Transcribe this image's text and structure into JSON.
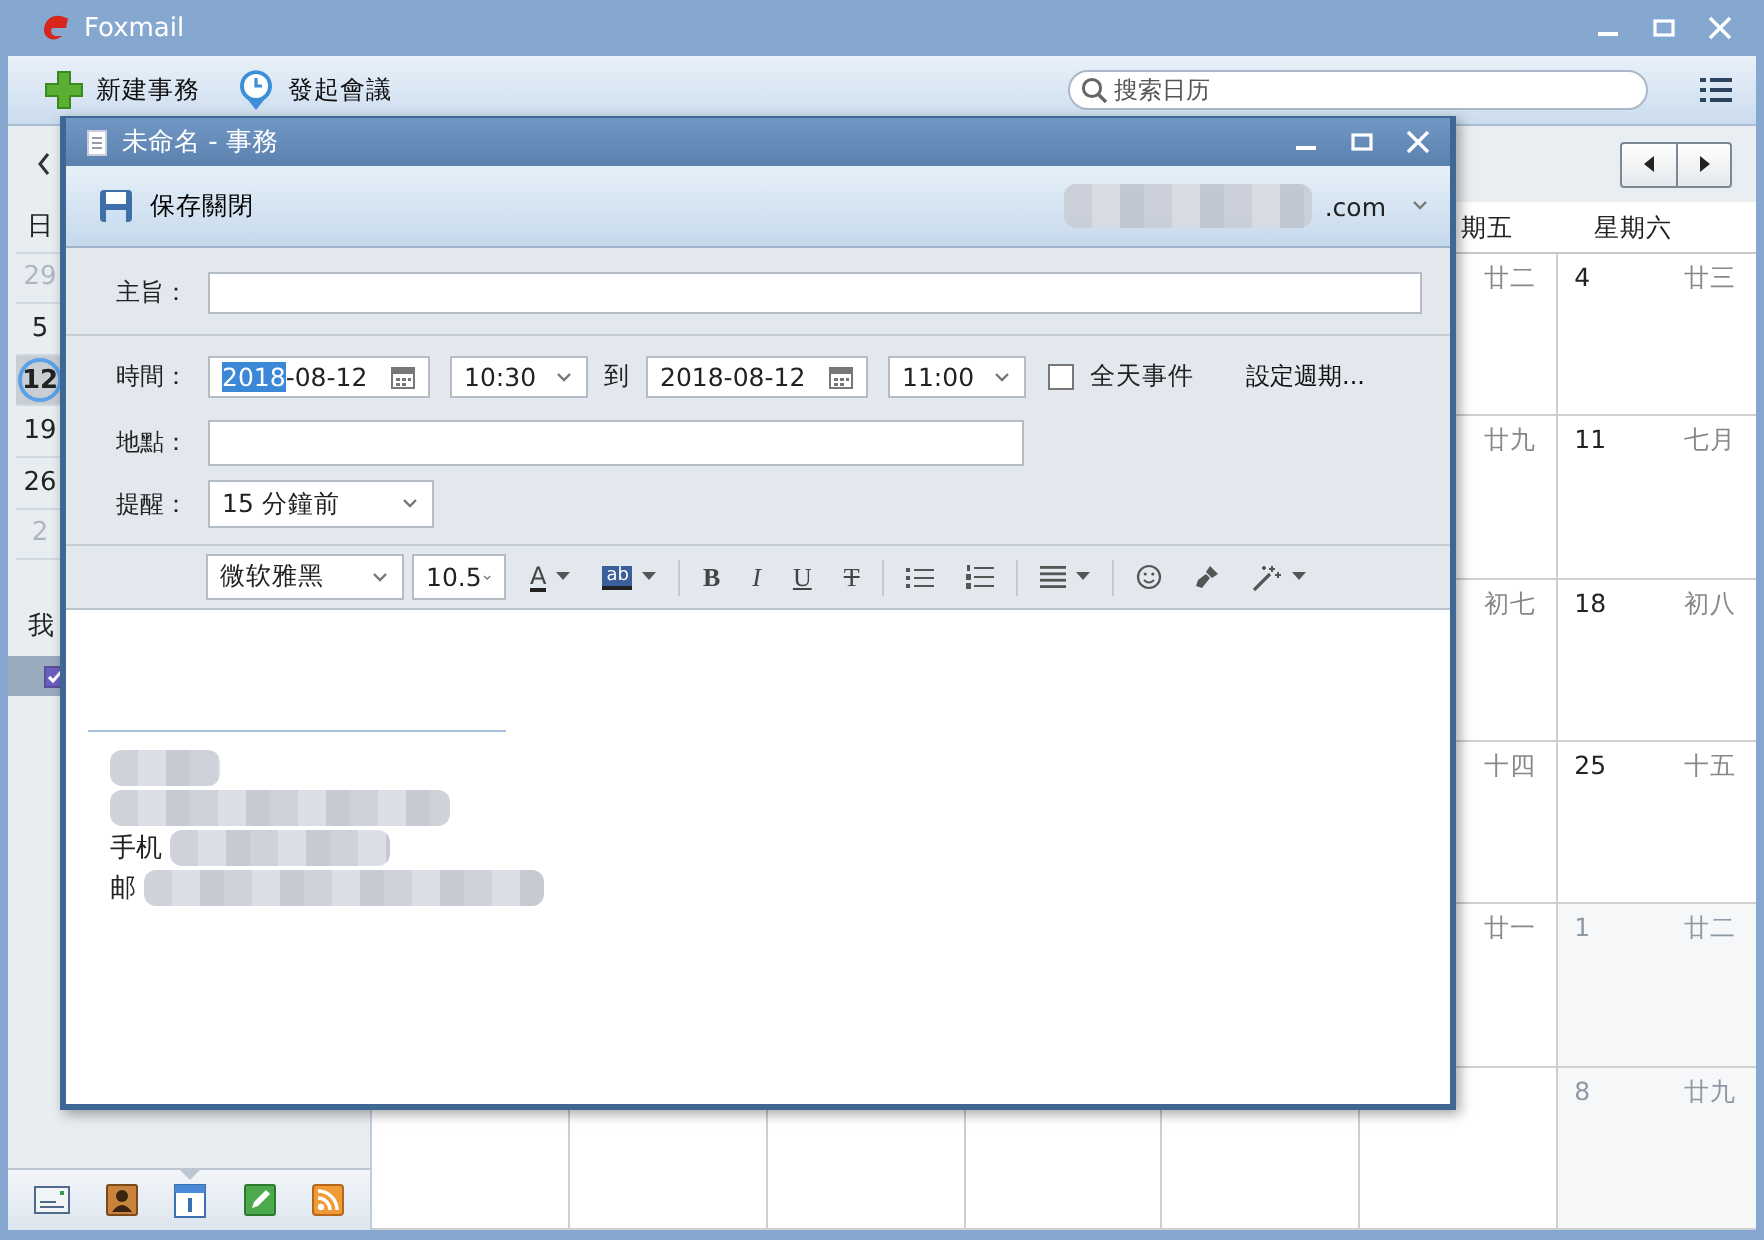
{
  "window": {
    "title": "Foxmail"
  },
  "toolbar": {
    "buttons": [
      {
        "label": "新建事務",
        "kind": "add"
      },
      {
        "label": "發起會議",
        "kind": "meeting"
      }
    ],
    "search": {
      "placeholder": "搜索日历"
    }
  },
  "mini_calendar": {
    "header": "日",
    "days": [
      {
        "label": "29",
        "other_month": true,
        "today": false,
        "selected": false
      },
      {
        "label": "5",
        "other_month": false,
        "today": false,
        "selected": false
      },
      {
        "label": "12",
        "other_month": false,
        "today": true,
        "selected": true
      },
      {
        "label": "19",
        "other_month": false,
        "today": false,
        "selected": false
      },
      {
        "label": "26",
        "other_month": false,
        "today": false,
        "selected": false
      },
      {
        "label": "2",
        "other_month": true,
        "today": false,
        "selected": false
      }
    ]
  },
  "calendars": {
    "heading": "我",
    "items": [
      {
        "checked": true
      }
    ]
  },
  "nav": [
    {
      "kind": "mail",
      "selected": false
    },
    {
      "kind": "contacts",
      "selected": false
    },
    {
      "kind": "calendar",
      "selected": true
    },
    {
      "kind": "notes",
      "selected": false
    },
    {
      "kind": "feeds",
      "selected": false
    }
  ],
  "calendar": {
    "weekday_headers": [
      "期五",
      "星期六"
    ],
    "rows": [
      {
        "friday": {
          "lunar": "廿二",
          "other_month": false
        },
        "saturday": {
          "day": "4",
          "lunar": "廿三",
          "other_month": false
        }
      },
      {
        "friday": {
          "lunar": "廿九",
          "other_month": false
        },
        "saturday": {
          "day": "11",
          "lunar": "七月",
          "other_month": false
        }
      },
      {
        "friday": {
          "lunar": "初七",
          "other_month": false
        },
        "saturday": {
          "day": "18",
          "lunar": "初八",
          "other_month": false
        }
      },
      {
        "friday": {
          "lunar": "十四",
          "other_month": false
        },
        "saturday": {
          "day": "25",
          "lunar": "十五",
          "other_month": false
        }
      },
      {
        "friday": {
          "lunar": "廿一",
          "other_month": false
        },
        "saturday": {
          "day": "1",
          "lunar": "廿二",
          "other_month": true
        }
      },
      {
        "saturday": {
          "day": "8",
          "lunar": "廿九",
          "other_month": true
        }
      }
    ]
  },
  "dialog": {
    "title": "未命名 - 事務",
    "save_button": "保存關閉",
    "account_suffix": ".com",
    "subject": {
      "label": "主旨："
    },
    "time": {
      "label": "時間：",
      "start_date_selected": "2018",
      "start_date_rest": "-08-12",
      "start_time": "10:30",
      "to": "到",
      "end_date": "2018-08-12",
      "end_time": "11:00",
      "all_day": {
        "label": "全天事件",
        "checked": false
      },
      "recurrence_link": "設定週期..."
    },
    "location": {
      "label": "地點："
    },
    "reminder": {
      "label": "提醒：",
      "value": "15 分鐘前"
    },
    "format_bar": {
      "font": "微软雅黑",
      "size": "10.5",
      "tools": [
        {
          "kind": "font-color",
          "glyph": "A",
          "caret": true
        },
        {
          "kind": "highlight",
          "glyph": "ab",
          "caret": true
        },
        {
          "kind": "separator"
        },
        {
          "kind": "bold",
          "glyph": "B",
          "caret": false
        },
        {
          "kind": "italic",
          "glyph": "I",
          "caret": false
        },
        {
          "kind": "underline",
          "glyph": "U",
          "caret": false
        },
        {
          "kind": "strike",
          "glyph": "T",
          "caret": false
        },
        {
          "kind": "separator"
        },
        {
          "kind": "bullets",
          "caret": false
        },
        {
          "kind": "numbering",
          "caret": false
        },
        {
          "kind": "separator"
        },
        {
          "kind": "align",
          "caret": true
        },
        {
          "kind": "separator"
        },
        {
          "kind": "emoji",
          "caret": false
        },
        {
          "kind": "clear",
          "caret": false
        },
        {
          "kind": "magic",
          "caret": true
        }
      ]
    },
    "signature_lines": [
      {
        "kind": "blurred"
      },
      {
        "kind": "blurred"
      },
      {
        "kind": "text",
        "text": "手机"
      },
      {
        "kind": "text",
        "text": "邮"
      }
    ]
  }
}
